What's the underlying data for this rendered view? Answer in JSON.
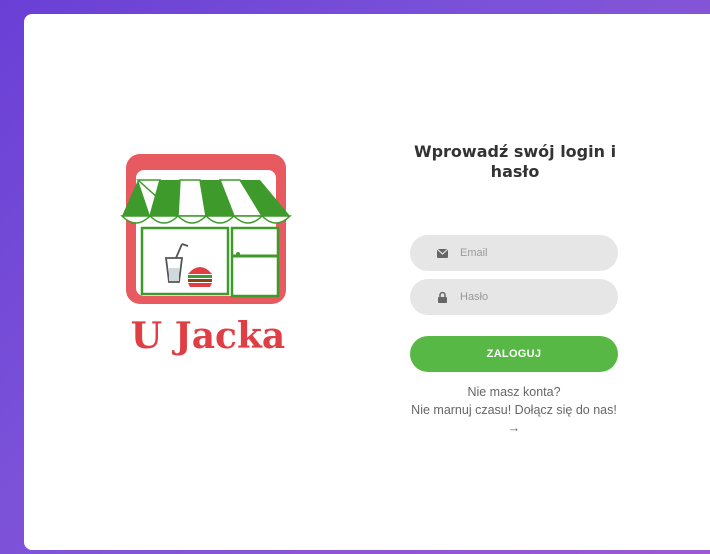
{
  "logo": {
    "text": "U Jacka",
    "colors": {
      "frame": "#e75a5f",
      "awning_green": "#3e9a2a",
      "text_red": "#e03e45"
    }
  },
  "login": {
    "title": "Wprowadź swój login i hasło",
    "email_placeholder": "Email",
    "password_placeholder": "Hasło",
    "email_icon": "envelope-icon",
    "password_icon": "lock-icon",
    "submit_label": "ZALOGUJ",
    "signup_question": "Nie masz konta?",
    "signup_link": "Nie marnuj czasu! Dołącz się do nas!",
    "signup_arrow": "→"
  },
  "colors": {
    "primary_button": "#57b846",
    "input_bg": "#e6e6e6",
    "background_gradient": [
      "#6a3fd6",
      "#9b59d4"
    ]
  }
}
